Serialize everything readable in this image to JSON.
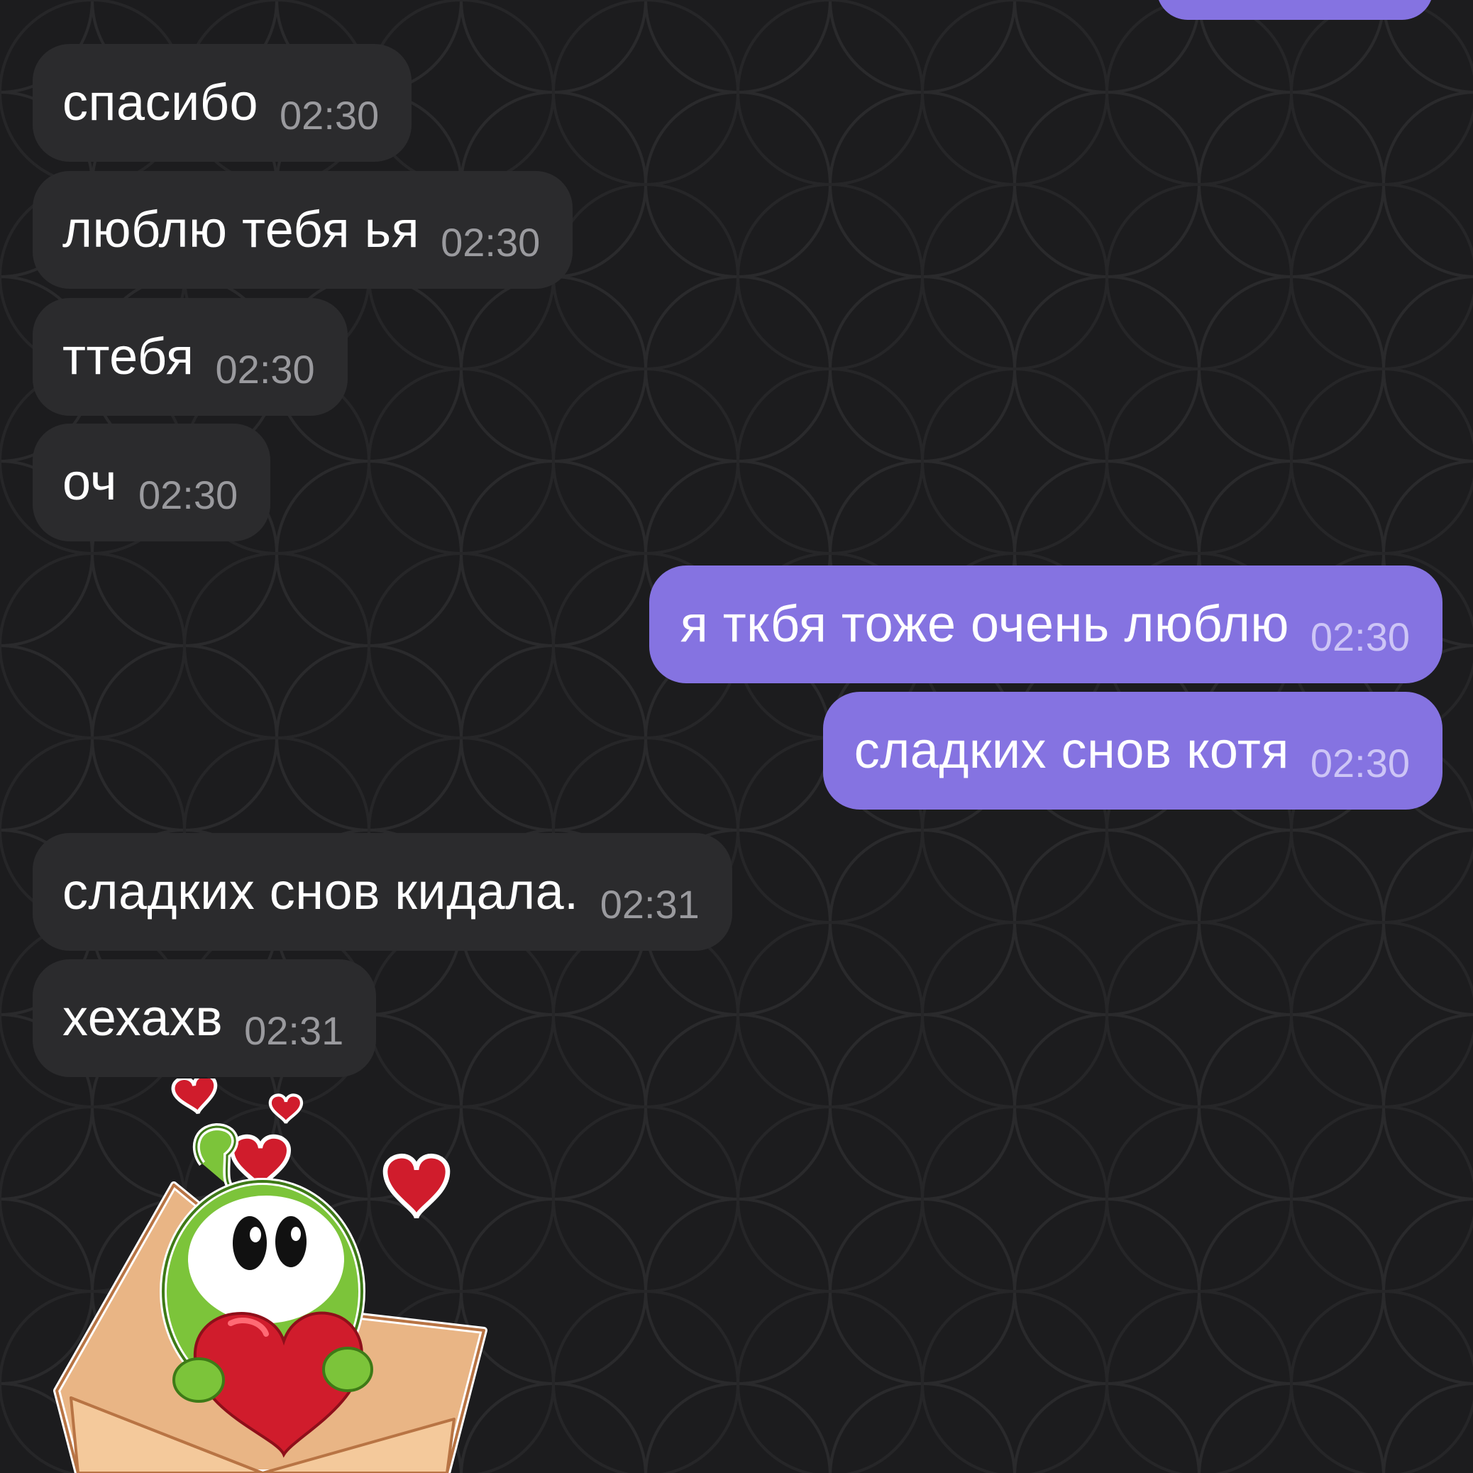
{
  "theme": {
    "background": "#1c1c1e",
    "incoming_bubble": "#2b2b2d",
    "outgoing_bubble": "#8573e1",
    "text": "#ffffff",
    "incoming_time": "#9a9a9e",
    "outgoing_time": "#cdc5f6"
  },
  "messages": [
    {
      "direction": "in",
      "text": "спасибо",
      "time": "02:30"
    },
    {
      "direction": "in",
      "text": "люблю тебя ья",
      "time": "02:30"
    },
    {
      "direction": "in",
      "text": "ттебя",
      "time": "02:30"
    },
    {
      "direction": "in",
      "text": "оч",
      "time": "02:30"
    },
    {
      "direction": "out",
      "text": "я ткбя тоже очень люблю",
      "time": "02:30"
    },
    {
      "direction": "out",
      "text": "сладких снов котя",
      "time": "02:30"
    },
    {
      "direction": "in",
      "text": "сладких снов кидала.",
      "time": "02:31"
    },
    {
      "direction": "in",
      "text": "хехахв",
      "time": "02:31"
    }
  ],
  "sticker": {
    "icon": "om-nom-love-letter-sticker",
    "colors": {
      "envelope": "#e9b585",
      "body": "#7cc43a",
      "heart": "#d01c2c"
    }
  }
}
